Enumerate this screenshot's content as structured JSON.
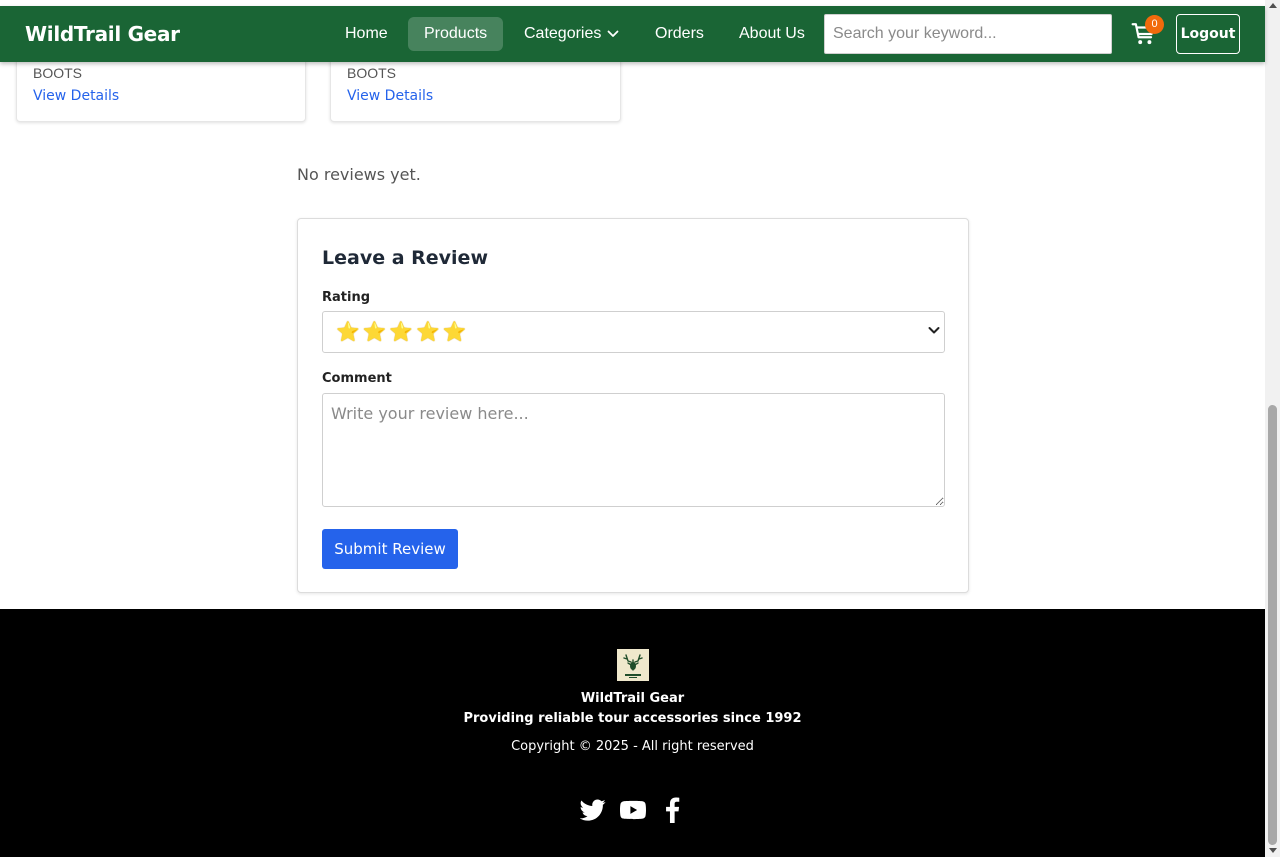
{
  "navbar": {
    "brand": "WildTrail Gear",
    "items": [
      {
        "label": "Home",
        "active": false
      },
      {
        "label": "Products",
        "active": true
      },
      {
        "label": "Categories",
        "active": false
      },
      {
        "label": "Orders",
        "active": false
      },
      {
        "label": "About Us",
        "active": false
      }
    ],
    "search_placeholder": "Search your keyword...",
    "cart_count": "0",
    "logout_label": "Logout",
    "colors": {
      "bar": "#1a6535",
      "badge": "#f26a0c"
    }
  },
  "related_products": [
    {
      "category": "BOOTS",
      "link_label": "View Details"
    },
    {
      "category": "BOOTS",
      "link_label": "View Details"
    }
  ],
  "reviews": {
    "empty_text": "No reviews yet."
  },
  "review_form": {
    "title": "Leave a Review",
    "rating_label": "Rating",
    "rating_value": "⭐⭐⭐⭐⭐",
    "rating_stars": 5,
    "comment_label": "Comment",
    "comment_placeholder": "Write your review here...",
    "submit_label": "Submit Review",
    "colors": {
      "submit": "#2563eb",
      "link": "#2563eb"
    }
  },
  "footer": {
    "company": "WildTrail Gear",
    "tagline": "Providing reliable tour accessories since 1992",
    "copyright": "Copyright © 2025 - All right reserved",
    "social_icons": [
      "twitter-icon",
      "youtube-icon",
      "facebook-icon"
    ],
    "background": "#000000"
  }
}
